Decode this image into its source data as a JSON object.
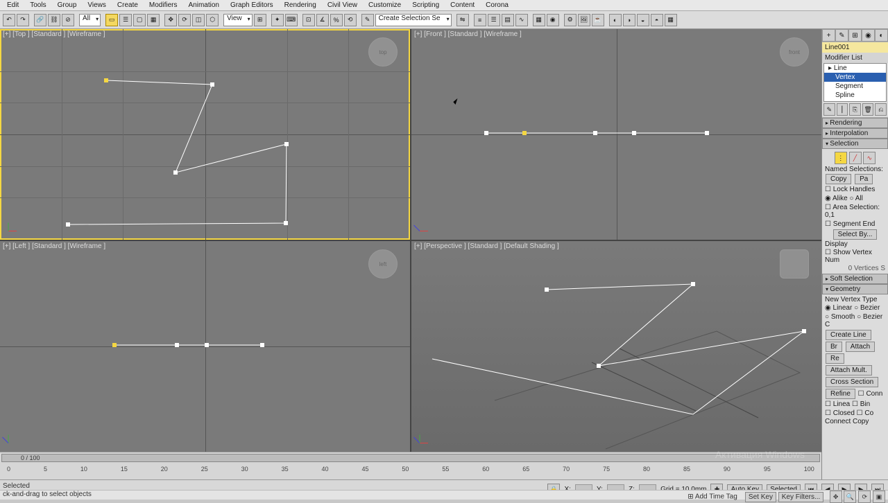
{
  "menu": [
    "Edit",
    "Tools",
    "Group",
    "Views",
    "Create",
    "Modifiers",
    "Animation",
    "Graph Editors",
    "Rendering",
    "Civil View",
    "Customize",
    "Scripting",
    "Content",
    "Corona"
  ],
  "tool_sel1": "All",
  "tool_sel2": "View",
  "tool_sel3": "Create Selection Se",
  "viewports": {
    "top": "[+] [Top ] [Standard ] [Wireframe ]",
    "front": "[+] [Front ] [Standard ] [Wireframe ]",
    "left": "[+] [Left ] [Standard ] [Wireframe ]",
    "persp": "[+] [Perspective ] [Standard ] [Default Shading ]"
  },
  "cube_top": "top",
  "cube_front": "front",
  "cube_left": "left",
  "panel": {
    "object_name": "Line001",
    "modifier_list": "Modifier List",
    "stack_top": "Line",
    "stack_sub": [
      "Vertex",
      "Segment",
      "Spline"
    ],
    "stack_sel": 0,
    "tools_row": [
      "✎",
      "⎮",
      "⎘",
      "🗑",
      "⎌"
    ],
    "rolls": {
      "rendering": "Rendering",
      "interp": "Interpolation",
      "selection": "Selection",
      "soft": "Soft Selection",
      "geom": "Geometry"
    },
    "selection": {
      "named": "Named Selections:",
      "copy": "Copy",
      "paste": "Pa",
      "lock": "Lock Handles",
      "alike": "Alike",
      "all": "All",
      "area": "Area Selection:",
      "area_v": "0,1",
      "segend": "Segment End",
      "selectby": "Select By...",
      "display": "Display",
      "showvn": "Show Vertex Num",
      "vsel": "0 Vertices S"
    },
    "geom": {
      "nvtype": "New Vertex Type",
      "linear": "Linear",
      "bezier": "Bezier",
      "smooth": "Smooth",
      "bezierc": "Bezier C",
      "create": "Create Line",
      "br": "Br",
      "attach": "Attach",
      "re": "Re",
      "attachm": "Attach Mult.",
      "cross": "Cross Section",
      "refine": "Refine",
      "conn": "Conn",
      "lin": "Linea",
      "bin": "Bin",
      "clo": "Closed",
      "con": "Co",
      "conncopy": "Connect Copy"
    }
  },
  "timeline": {
    "caption": "0 / 100",
    "ticks": [
      "0",
      "5",
      "10",
      "15",
      "20",
      "25",
      "30",
      "35",
      "40",
      "45",
      "50",
      "55",
      "60",
      "65",
      "70",
      "75",
      "80",
      "85",
      "90",
      "95",
      "100"
    ]
  },
  "status": {
    "x": "X:",
    "y": "Y:",
    "z": "Z:",
    "grid": "Grid = 10,0mm",
    "autokey": "Auto Key",
    "selected": "Selected",
    "setkey": "Set Key",
    "keyfilters": "Key Filters...",
    "addtag": "Add Time Tag",
    "hint_sel": "Selected",
    "hint": "ck-and-drag to select objects"
  },
  "watermark": "Активация Windows"
}
